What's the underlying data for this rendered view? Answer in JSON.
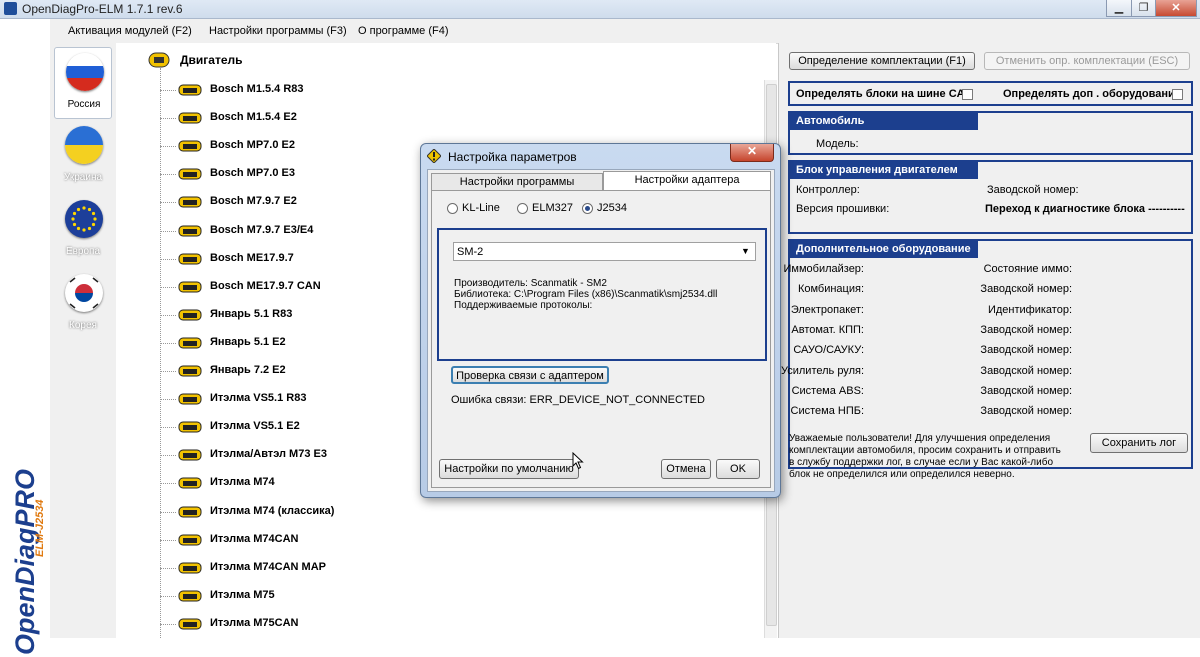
{
  "window": {
    "title": "OpenDiagPro-ELM 1.7.1 rev.6",
    "minimize_glyph": "▁",
    "restore_glyph": "❐",
    "close_glyph": "✕"
  },
  "menu": {
    "items": [
      "Активация модулей (F2)",
      "Настройки программы (F3)",
      "О программе (F4)"
    ]
  },
  "logo": {
    "text": "OpenDiagPRO",
    "subtext": "ELM-J2534"
  },
  "countries": [
    {
      "label": "Россия",
      "selected": true
    },
    {
      "label": "Украина",
      "selected": false
    },
    {
      "label": "Европа",
      "selected": false
    },
    {
      "label": "Корея",
      "selected": false
    }
  ],
  "tree": {
    "root": "Двигатель",
    "items": [
      "Bosch M1.5.4 R83",
      "Bosch M1.5.4 E2",
      "Bosch MP7.0 E2",
      "Bosch MP7.0 E3",
      "Bosch M7.9.7 E2",
      "Bosch M7.9.7 E3/E4",
      "Bosch ME17.9.7",
      "Bosch ME17.9.7 CAN",
      "Январь 5.1 R83",
      "Январь 5.1 E2",
      "Январь 7.2 E2",
      "Итэлма VS5.1 R83",
      "Итэлма VS5.1 E2",
      "Итэлма/Автэл М73 E3",
      "Итэлма М74",
      "Итэлма М74 (классика)",
      "Итэлма М74CAN",
      "Итэлма М74CAN MAP",
      "Итэлма М75",
      "Итэлма М75CAN"
    ]
  },
  "right": {
    "detect_button": "Определение комплектации (F1)",
    "cancel_detect_button": "Отменить опр. комплектации (ESC)",
    "can_bus_label": "Определять блоки на шине CAN",
    "extra_equipment_label": "Определять доп . оборудование",
    "car_group": {
      "title": "Автомобиль",
      "model_label": "Модель:"
    },
    "ecu_group": {
      "title": "Блок управления  двигателем",
      "controller_label": "Контроллер:",
      "serial_label": "Заводской номер:",
      "firmware_label": "Версия прошивки:",
      "goto_label": "Переход к диагностике блока ----------"
    },
    "extra_group": {
      "title": "Дополнительное оборудование",
      "rows": [
        {
          "left": "Иммобилайзер:",
          "right": "Состояние иммо:"
        },
        {
          "left": "Комбинация:",
          "right": "Заводской номер:"
        },
        {
          "left": "Электропакет:",
          "right": "Идентификатор:"
        },
        {
          "left": "Автомат. КПП:",
          "right": "Заводской номер:"
        },
        {
          "left": "САУО/САУКУ:",
          "right": "Заводской номер:"
        },
        {
          "left": "Усилитель руля:",
          "right": "Заводской номер:"
        },
        {
          "left": "Система ABS:",
          "right": "Заводской номер:"
        },
        {
          "left": "Система НПБ:",
          "right": "Заводской номер:"
        }
      ]
    },
    "notice_lines": [
      "Уважаемые пользователи! Для улучшения определения",
      "комплектации автомобиля, просим сохранить и отправить",
      " в службу поддержки лог, в случае если у Вас какой-либо",
      "блок не определился или определился неверно."
    ],
    "save_log_button": "Сохранить лог"
  },
  "dialog": {
    "title": "Настройка параметров",
    "close_glyph": "✕",
    "tabs": [
      {
        "label": "Настройки программы",
        "active": false
      },
      {
        "label": "Настройки адаптера",
        "active": true
      }
    ],
    "adapter_types": [
      {
        "label": "KL-Line",
        "checked": false
      },
      {
        "label": "ELM327",
        "checked": false
      },
      {
        "label": "J2534",
        "checked": true
      }
    ],
    "device_select": "SM-2",
    "info_lines": [
      "Производитель: Scanmatik - SM2",
      "Библиотека: C:\\Program Files (x86)\\Scanmatik\\smj2534.dll",
      "Поддерживаемые протоколы:"
    ],
    "check_button": "Проверка связи с адаптером",
    "error_text": "Ошибка связи: ERR_DEVICE_NOT_CONNECTED",
    "defaults_button": "Настройки по умолчанию",
    "cancel_button": "Отмена",
    "ok_button": "OK"
  }
}
